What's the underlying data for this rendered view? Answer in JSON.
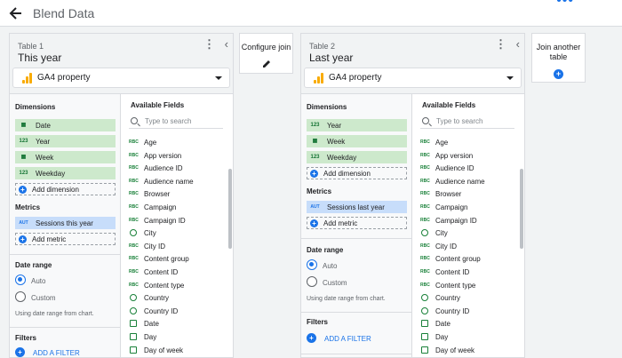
{
  "header": {
    "title": "Blend Data",
    "more_icon": "more-horiz-icon"
  },
  "config_join": {
    "label": "Configure join"
  },
  "join_another": {
    "label_line1": "Join another",
    "label_line2": "table",
    "plus": "+"
  },
  "tables": [
    {
      "table_label": "Table 1",
      "table_name": "This year",
      "source": "GA4 property",
      "dimensions_heading": "Dimensions",
      "dimensions": [
        {
          "icon": "calendar-icon",
          "label": "Date"
        },
        {
          "icon": "123",
          "label": "Year"
        },
        {
          "icon": "calendar-icon",
          "label": "Week"
        },
        {
          "icon": "123",
          "label": "Weekday"
        }
      ],
      "add_dimension": "Add dimension",
      "metrics_heading": "Metrics",
      "metrics": [
        {
          "icon": "AUT",
          "label": "Sessions this year"
        }
      ],
      "add_metric": "Add metric",
      "date_range_heading": "Date range",
      "date_range_options": [
        {
          "label": "Auto",
          "selected": true
        },
        {
          "label": "Custom",
          "selected": false
        }
      ],
      "date_range_note": "Using date range from chart.",
      "filters_heading": "Filters",
      "add_filter": "ADD A FILTER",
      "available_fields_heading": "Available Fields",
      "search_placeholder": "Type to search",
      "fields": [
        {
          "type": "RBC",
          "label": "Age"
        },
        {
          "type": "RBC",
          "label": "App version"
        },
        {
          "type": "RBC",
          "label": "Audience ID"
        },
        {
          "type": "RBC",
          "label": "Audience name"
        },
        {
          "type": "RBC",
          "label": "Browser"
        },
        {
          "type": "RBC",
          "label": "Campaign"
        },
        {
          "type": "RBC",
          "label": "Campaign ID"
        },
        {
          "type": "geo",
          "label": "City"
        },
        {
          "type": "RBC",
          "label": "City ID"
        },
        {
          "type": "RBC",
          "label": "Content group"
        },
        {
          "type": "RBC",
          "label": "Content ID"
        },
        {
          "type": "RBC",
          "label": "Content type"
        },
        {
          "type": "geo",
          "label": "Country"
        },
        {
          "type": "geo",
          "label": "Country ID"
        },
        {
          "type": "cal",
          "label": "Date"
        },
        {
          "type": "cal",
          "label": "Day"
        },
        {
          "type": "cal",
          "label": "Day of week"
        }
      ]
    },
    {
      "table_label": "Table 2",
      "table_name": "Last year",
      "source": "GA4 property",
      "dimensions_heading": "Dimensions",
      "dimensions": [
        {
          "icon": "123",
          "label": "Year"
        },
        {
          "icon": "calendar-icon",
          "label": "Week"
        },
        {
          "icon": "123",
          "label": "Weekday"
        }
      ],
      "add_dimension": "Add dimension",
      "metrics_heading": "Metrics",
      "metrics": [
        {
          "icon": "AUT",
          "label": "Sessions last year"
        }
      ],
      "add_metric": "Add metric",
      "date_range_heading": "Date range",
      "date_range_options": [
        {
          "label": "Auto",
          "selected": true
        },
        {
          "label": "Custom",
          "selected": false
        }
      ],
      "date_range_note": "Using date range from chart.",
      "filters_heading": "Filters",
      "add_filter": "ADD A FILTER",
      "available_fields_heading": "Available Fields",
      "search_placeholder": "Type to search",
      "fields": [
        {
          "type": "RBC",
          "label": "Age"
        },
        {
          "type": "RBC",
          "label": "App version"
        },
        {
          "type": "RBC",
          "label": "Audience ID"
        },
        {
          "type": "RBC",
          "label": "Audience name"
        },
        {
          "type": "RBC",
          "label": "Browser"
        },
        {
          "type": "RBC",
          "label": "Campaign"
        },
        {
          "type": "RBC",
          "label": "Campaign ID"
        },
        {
          "type": "geo",
          "label": "City"
        },
        {
          "type": "RBC",
          "label": "City ID"
        },
        {
          "type": "RBC",
          "label": "Content group"
        },
        {
          "type": "RBC",
          "label": "Content ID"
        },
        {
          "type": "RBC",
          "label": "Content type"
        },
        {
          "type": "geo",
          "label": "Country"
        },
        {
          "type": "geo",
          "label": "Country ID"
        },
        {
          "type": "cal",
          "label": "Date"
        },
        {
          "type": "cal",
          "label": "Day"
        },
        {
          "type": "cal",
          "label": "Day of week"
        }
      ]
    }
  ]
}
